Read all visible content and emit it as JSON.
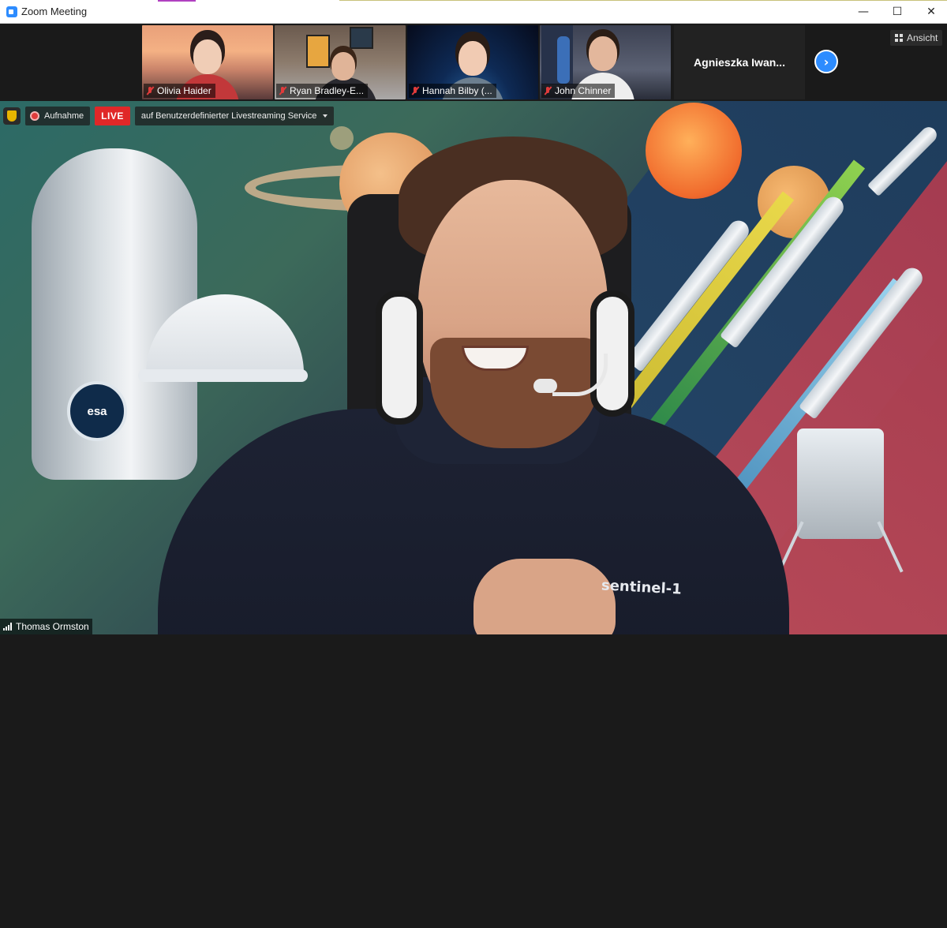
{
  "window": {
    "title": "Zoom Meeting",
    "minimize_glyph": "—",
    "maximize_glyph": "☐",
    "close_glyph": "✕"
  },
  "gallery": {
    "participants": [
      {
        "name": "Olivia Haider",
        "muted": true
      },
      {
        "name": "Ryan Bradley-E...",
        "muted": true
      },
      {
        "name": "Hannah Bilby (...",
        "muted": true
      },
      {
        "name": "John Chinner",
        "muted": true
      }
    ],
    "overflow_name": "Agnieszka  Iwan...",
    "next_glyph": "›",
    "view_label": "Ansicht"
  },
  "stage": {
    "recording_label": "Aufnahme",
    "live_label": "LIVE",
    "stream_label": "auf Benutzerdefinierter Livestreaming Service",
    "speaker_name": "Thomas Ormston",
    "shirt_text": "sentinel-1",
    "badge_text": "esa"
  },
  "colors": {
    "zoom_blue": "#2d8cff",
    "live_red": "#e02828",
    "mute_red": "#e03b3b"
  },
  "icons": {
    "mute": "microphone-muted-icon",
    "shield": "security-shield-icon",
    "record": "recording-dot-icon",
    "view": "grid-view-icon",
    "signal": "signal-strength-icon"
  }
}
